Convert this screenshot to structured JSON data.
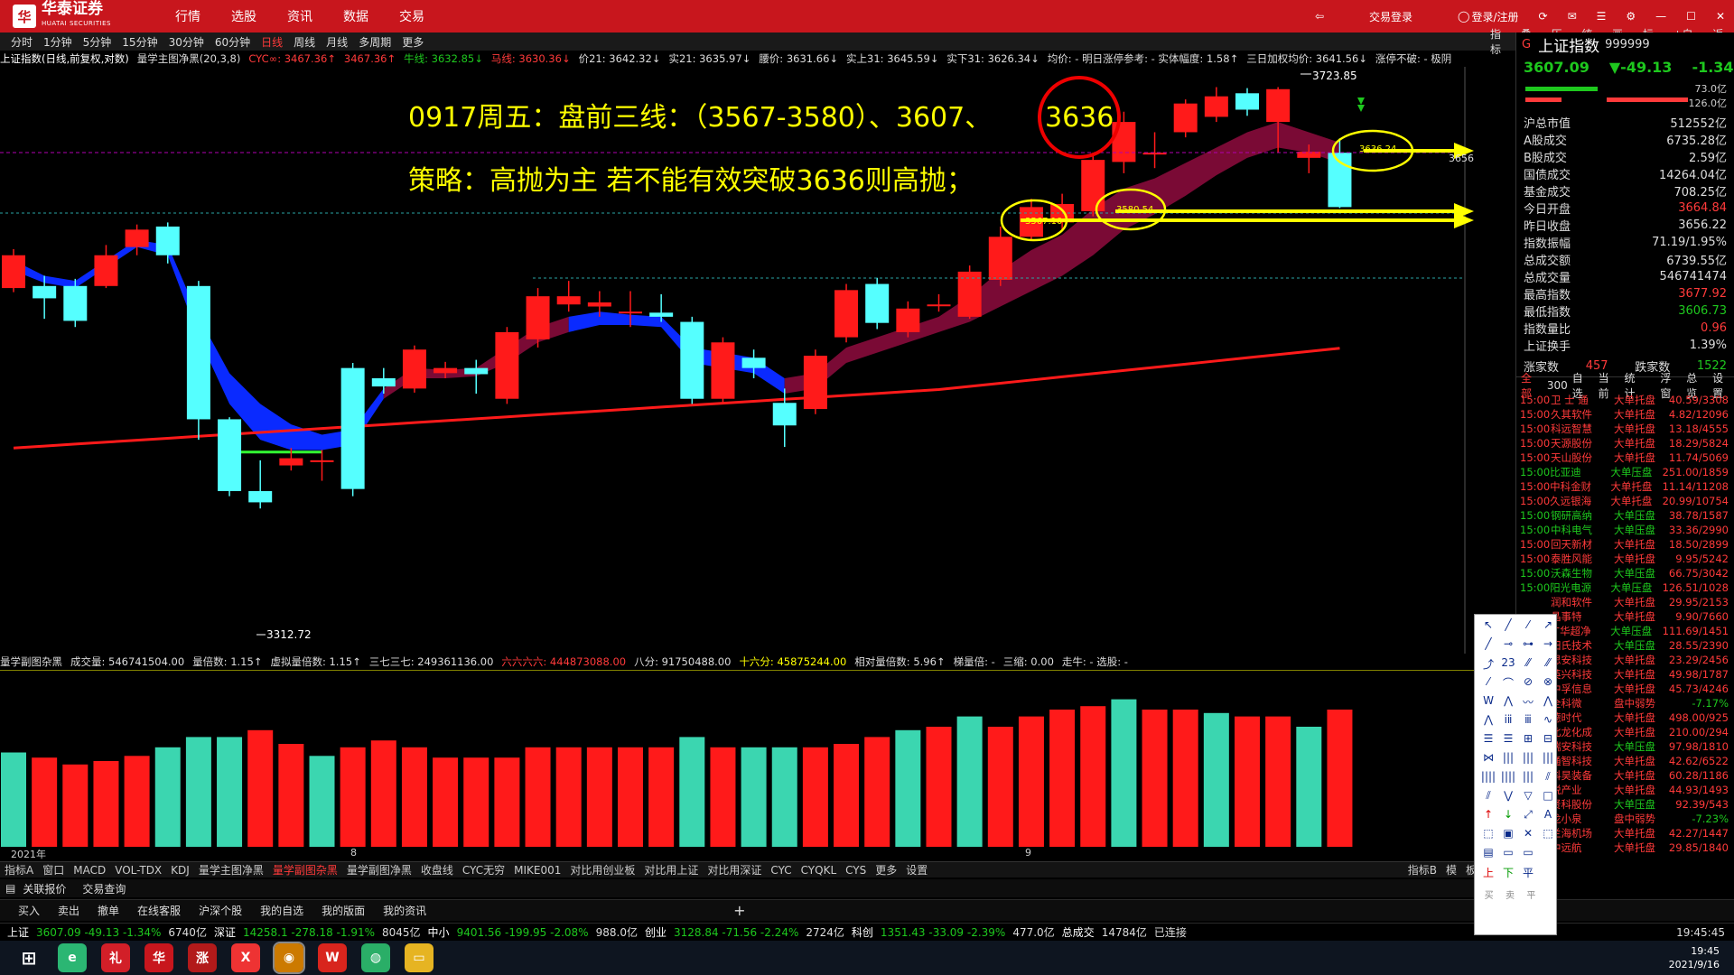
{
  "topbar": {
    "logo_text": "华泰证券",
    "logo_sub": "HUATAI SECURITIES",
    "menu": [
      "行情",
      "选股",
      "资讯",
      "数据",
      "交易"
    ],
    "right_items": [
      "交易登录",
      "登录/注册"
    ]
  },
  "period_bar": {
    "items": [
      "分时",
      "1分钟",
      "5分钟",
      "15分钟",
      "30分钟",
      "60分钟",
      "日线",
      "周线",
      "月线",
      "多周期",
      "更多"
    ],
    "active": "日线"
  },
  "tools_bar": [
    "指标",
    "叠加",
    "历史",
    "统计",
    "画线",
    "标记",
    "+自选",
    "返回"
  ],
  "info_bar": [
    {
      "text": "上证指数(日线,前复权,对数)",
      "color": "#ffffff"
    },
    {
      "text": "量学主图净黑(20,3,8)",
      "color": "#dddddd"
    },
    {
      "text": "CYC∞: 3467.36↑",
      "color": "#ff3a3a"
    },
    {
      "text": "3467.36↑",
      "color": "#ff3a3a"
    },
    {
      "text": "牛线: 3632.85↓",
      "color": "#1ec81e"
    },
    {
      "text": "马线: 3630.36↓",
      "color": "#ff3a3a"
    },
    {
      "text": "价21: 3642.32↓",
      "color": "#dddddd"
    },
    {
      "text": "实21: 3635.97↓",
      "color": "#dddddd"
    },
    {
      "text": "腰价: 3631.66↓",
      "color": "#dddddd"
    },
    {
      "text": "实上31: 3645.59↓",
      "color": "#dddddd"
    },
    {
      "text": "实下31: 3626.34↓",
      "color": "#dddddd"
    },
    {
      "text": "均价: - 明日涨停参考: - 实体幅度: 1.58↑",
      "color": "#dddddd"
    },
    {
      "text": "三日加权均价: 3641.56↓",
      "color": "#dddddd"
    },
    {
      "text": "涨停不破: - 极阴",
      "color": "#dddddd"
    }
  ],
  "annotations": {
    "line1": "0917周五：盘前三线：（3567-3580）、3607、",
    "line1_circled": "3636",
    "line2": "策略：高抛为主  若不能有效突破3636则高抛；",
    "price_high": "3723.85",
    "price_low": "3312.72",
    "label_3567": "3567.10",
    "label_3580": "3580.54",
    "label_3636": "3636.24",
    "axis_right": "3656"
  },
  "chart_data": {
    "type": "candlestick",
    "title": "上证指数(日线,前复权,对数)",
    "candles": [
      {
        "o": 3528,
        "c": 3560,
        "h": 3566,
        "l": 3524
      },
      {
        "o": 3530,
        "c": 3518,
        "h": 3540,
        "l": 3498
      },
      {
        "o": 3530,
        "c": 3496,
        "h": 3537,
        "l": 3490
      },
      {
        "o": 3530,
        "c": 3560,
        "h": 3570,
        "l": 3528
      },
      {
        "o": 3568,
        "c": 3585,
        "h": 3590,
        "l": 3560
      },
      {
        "o": 3588,
        "c": 3560,
        "h": 3592,
        "l": 3552
      },
      {
        "o": 3530,
        "c": 3400,
        "h": 3535,
        "l": 3380
      },
      {
        "o": 3400,
        "c": 3330,
        "h": 3402,
        "l": 3325
      },
      {
        "o": 3330,
        "c": 3319,
        "h": 3360,
        "l": 3313
      },
      {
        "o": 3355,
        "c": 3362,
        "h": 3372,
        "l": 3350
      },
      {
        "o": 3360,
        "c": 3360,
        "h": 3370,
        "l": 3340
      },
      {
        "o": 3450,
        "c": 3332,
        "h": 3455,
        "l": 3325
      },
      {
        "o": 3440,
        "c": 3432,
        "h": 3450,
        "l": 3425
      },
      {
        "o": 3430,
        "c": 3468,
        "h": 3472,
        "l": 3426
      },
      {
        "o": 3445,
        "c": 3450,
        "h": 3456,
        "l": 3440
      },
      {
        "o": 3450,
        "c": 3444,
        "h": 3458,
        "l": 3425
      },
      {
        "o": 3420,
        "c": 3485,
        "h": 3490,
        "l": 3415
      },
      {
        "o": 3478,
        "c": 3520,
        "h": 3528,
        "l": 3470
      },
      {
        "o": 3512,
        "c": 3520,
        "h": 3535,
        "l": 3505
      },
      {
        "o": 3510,
        "c": 3514,
        "h": 3525,
        "l": 3500
      },
      {
        "o": 3505,
        "c": 3505,
        "h": 3525,
        "l": 3490
      },
      {
        "o": 3504,
        "c": 3500,
        "h": 3522,
        "l": 3495
      },
      {
        "o": 3495,
        "c": 3420,
        "h": 3500,
        "l": 3415
      },
      {
        "o": 3420,
        "c": 3475,
        "h": 3480,
        "l": 3415
      },
      {
        "o": 3460,
        "c": 3450,
        "h": 3468,
        "l": 3440
      },
      {
        "o": 3416,
        "c": 3394,
        "h": 3430,
        "l": 3373
      },
      {
        "o": 3410,
        "c": 3462,
        "h": 3468,
        "l": 3405
      },
      {
        "o": 3480,
        "c": 3526,
        "h": 3532,
        "l": 3475
      },
      {
        "o": 3532,
        "c": 3494,
        "h": 3538,
        "l": 3488
      },
      {
        "o": 3485,
        "c": 3508,
        "h": 3515,
        "l": 3480
      },
      {
        "o": 3512,
        "c": 3512,
        "h": 3522,
        "l": 3505
      },
      {
        "o": 3500,
        "c": 3544,
        "h": 3550,
        "l": 3498
      },
      {
        "o": 3536,
        "c": 3578,
        "h": 3588,
        "l": 3530
      },
      {
        "o": 3578,
        "c": 3607,
        "h": 3615,
        "l": 3575
      },
      {
        "o": 3592,
        "c": 3610,
        "h": 3620,
        "l": 3585
      },
      {
        "o": 3603,
        "c": 3653,
        "h": 3660,
        "l": 3598
      },
      {
        "o": 3651,
        "c": 3690,
        "h": 3700,
        "l": 3640
      },
      {
        "o": 3660,
        "c": 3660,
        "h": 3680,
        "l": 3645
      },
      {
        "o": 3680,
        "c": 3708,
        "h": 3712,
        "l": 3675
      },
      {
        "o": 3695,
        "c": 3715,
        "h": 3724,
        "l": 3690
      },
      {
        "o": 3718,
        "c": 3702,
        "h": 3723,
        "l": 3696
      },
      {
        "o": 3690,
        "c": 3722,
        "h": 3724,
        "l": 3660
      },
      {
        "o": 3655,
        "c": 3661,
        "h": 3668,
        "l": 3640
      },
      {
        "o": 3660,
        "c": 3607,
        "h": 3674,
        "l": 3606
      }
    ],
    "volume_colors": [
      "g",
      "r",
      "r",
      "r",
      "r",
      "g",
      "g",
      "g",
      "r",
      "r",
      "g",
      "r",
      "r",
      "r",
      "r",
      "r",
      "r",
      "r",
      "r",
      "r",
      "r",
      "r",
      "g",
      "r",
      "g",
      "g",
      "r",
      "r",
      "r",
      "g",
      "r",
      "g",
      "r",
      "r",
      "r",
      "r",
      "g",
      "r",
      "r",
      "g",
      "r",
      "r",
      "g",
      "r"
    ],
    "volume_levels": [
      0.55,
      0.52,
      0.48,
      0.5,
      0.53,
      0.58,
      0.64,
      0.64,
      0.68,
      0.6,
      0.53,
      0.58,
      0.62,
      0.58,
      0.52,
      0.52,
      0.52,
      0.58,
      0.58,
      0.58,
      0.58,
      0.58,
      0.64,
      0.58,
      0.58,
      0.58,
      0.58,
      0.6,
      0.64,
      0.68,
      0.7,
      0.76,
      0.7,
      0.76,
      0.8,
      0.82,
      0.86,
      0.8,
      0.8,
      0.78,
      0.76,
      0.76,
      0.7,
      0.8
    ]
  },
  "vol_info": [
    {
      "text": "量学副图杂黑",
      "color": "#dddddd"
    },
    {
      "text": "成交量: 546741504.00",
      "color": "#dddddd"
    },
    {
      "text": "量倍数: 1.15↑",
      "color": "#dddddd"
    },
    {
      "text": "虚拟量倍数: 1.15↑",
      "color": "#dddddd"
    },
    {
      "text": "三七三七: 249361136.00",
      "color": "#dddddd"
    },
    {
      "text": "六六六六: 444873088.00",
      "color": "#ff3a3a"
    },
    {
      "text": "八分: 91750488.00",
      "color": "#dddddd"
    },
    {
      "text": "十六分: 45875244.00",
      "color": "#ffff00"
    },
    {
      "text": "相对量倍数: 5.96↑",
      "color": "#dddddd"
    },
    {
      "text": "梯量倍: -",
      "color": "#dddddd"
    },
    {
      "text": "三缩: 0.00",
      "color": "#dddddd"
    },
    {
      "text": "走牛: - 选股: -",
      "color": "#dddddd"
    }
  ],
  "date_labels": [
    "2021年",
    "8",
    "9"
  ],
  "indicator_tabs": {
    "items": [
      "指标A",
      "窗口",
      "MACD",
      "VOL-TDX",
      "KDJ",
      "量学主图净黑",
      "量学副图杂黑",
      "量学副图净黑",
      "收盘线",
      "CYC无穷",
      "MIKE001",
      "对比用创业板",
      "对比用上证",
      "对比用深证",
      "CYC",
      "CYQKL",
      "CYS",
      "更多",
      "设置"
    ],
    "active": "量学副图杂黑",
    "right": [
      "指标B",
      "模",
      "板"
    ]
  },
  "quick_tabs": [
    "关联报价",
    "交易查询"
  ],
  "trade_bar": [
    "买入",
    "卖出",
    "撤单",
    "在线客服",
    "沪深个股",
    "我的自选",
    "我的版面",
    "我的资讯"
  ],
  "status_bar": [
    {
      "text": "上证",
      "color": "#ffffff"
    },
    {
      "text": "3607.09 -49.13 -1.34%",
      "color": "#1ec81e"
    },
    {
      "text": "6740亿",
      "color": "#dddddd"
    },
    {
      "text": "深证",
      "color": "#ffffff"
    },
    {
      "text": "14258.1 -278.18 -1.91%",
      "color": "#1ec81e"
    },
    {
      "text": "8045亿",
      "color": "#dddddd"
    },
    {
      "text": "中小",
      "color": "#ffffff"
    },
    {
      "text": "9401.56 -199.95 -2.08%",
      "color": "#1ec81e"
    },
    {
      "text": "988.0亿",
      "color": "#dddddd"
    },
    {
      "text": "创业",
      "color": "#ffffff"
    },
    {
      "text": "3128.84 -71.56 -2.24%",
      "color": "#1ec81e"
    },
    {
      "text": "2724亿",
      "color": "#dddddd"
    },
    {
      "text": "科创",
      "color": "#ffffff"
    },
    {
      "text": "1351.43 -33.09 -2.39%",
      "color": "#1ec81e"
    },
    {
      "text": "477.0亿",
      "color": "#dddddd"
    },
    {
      "text": "总成交",
      "color": "#ffffff"
    },
    {
      "text": "14784亿",
      "color": "#dddddd"
    },
    {
      "text": "已连接",
      "color": "#dddddd"
    },
    {
      "text": "19:45:45",
      "color": "#dddddd"
    }
  ],
  "side_panel": {
    "g": "G",
    "title": "上证指数",
    "code": "999999",
    "price": "3607.09",
    "change": "▼-49.13",
    "change_pct": "-1.34%",
    "bar_vals": [
      "73.0亿",
      "126.0亿"
    ],
    "rows": [
      {
        "k": "沪总市值",
        "v": "512552亿",
        "c": "#dddddd"
      },
      {
        "k": "A股成交",
        "v": "6735.28亿",
        "c": "#dddddd"
      },
      {
        "k": "B股成交",
        "v": "2.59亿",
        "c": "#dddddd"
      },
      {
        "k": "国债成交",
        "v": "14264.04亿",
        "c": "#dddddd"
      },
      {
        "k": "基金成交",
        "v": "708.25亿",
        "c": "#dddddd"
      },
      {
        "k": "今日开盘",
        "v": "3664.84",
        "c": "#ff3a3a"
      },
      {
        "k": "昨日收盘",
        "v": "3656.22",
        "c": "#dddddd"
      },
      {
        "k": "指数振幅",
        "v": "71.19/1.95%",
        "c": "#dddddd"
      },
      {
        "k": "总成交额",
        "v": "6739.55亿",
        "c": "#dddddd"
      },
      {
        "k": "总成交量",
        "v": "546741474",
        "c": "#dddddd"
      },
      {
        "k": "最高指数",
        "v": "3677.92",
        "c": "#ff3a3a"
      },
      {
        "k": "最低指数",
        "v": "3606.73",
        "c": "#1ec81e"
      },
      {
        "k": "指数量比",
        "v": "0.96",
        "c": "#ff3a3a"
      },
      {
        "k": "上证换手",
        "v": "1.39%",
        "c": "#dddddd"
      }
    ],
    "up_label": "涨家数",
    "up_value": "457",
    "down_label": "跌家数",
    "down_value": "1522",
    "list_tabs": [
      "全部",
      "300",
      "自选",
      "当前",
      "统计",
      "浮窗",
      "总览",
      "设置"
    ],
    "stocks": [
      {
        "t": "15:00",
        "n": "卫 士 通",
        "s": "大单托盘",
        "v": "40.59/3308",
        "nc": "#ff3a3a"
      },
      {
        "t": "15:00",
        "n": "久其软件",
        "s": "大单托盘",
        "v": "4.82/12096",
        "nc": "#ff3a3a"
      },
      {
        "t": "15:00",
        "n": "科远智慧",
        "s": "大单托盘",
        "v": "13.18/4555",
        "nc": "#ff3a3a"
      },
      {
        "t": "15:00",
        "n": "天源股份",
        "s": "大单托盘",
        "v": "18.29/5824",
        "nc": "#ff3a3a"
      },
      {
        "t": "15:00",
        "n": "天山股份",
        "s": "大单托盘",
        "v": "11.74/5069",
        "nc": "#ff3a3a"
      },
      {
        "t": "15:00",
        "n": "比亚迪",
        "s": "大单压盘",
        "v": "251.00/1859",
        "nc": "#1ec81e"
      },
      {
        "t": "15:00",
        "n": "中科金财",
        "s": "大单托盘",
        "v": "11.14/11208",
        "nc": "#ff3a3a"
      },
      {
        "t": "15:00",
        "n": "久远银海",
        "s": "大单托盘",
        "v": "20.99/10754",
        "nc": "#ff3a3a"
      },
      {
        "t": "15:00",
        "n": "钢研高纳",
        "s": "大单压盘",
        "v": "38.78/1587",
        "nc": "#1ec81e"
      },
      {
        "t": "15:00",
        "n": "中科电气",
        "s": "大单压盘",
        "v": "33.36/2990",
        "nc": "#1ec81e"
      },
      {
        "t": "15:00",
        "n": "回天新材",
        "s": "大单托盘",
        "v": "18.50/2899",
        "nc": "#ff3a3a"
      },
      {
        "t": "15:00",
        "n": "泰胜风能",
        "s": "大单托盘",
        "v": "9.95/5242",
        "nc": "#ff3a3a"
      },
      {
        "t": "15:00",
        "n": "沃森生物",
        "s": "大单压盘",
        "v": "66.75/3042",
        "nc": "#1ec81e"
      },
      {
        "t": "15:00",
        "n": "阳光电源",
        "s": "大单压盘",
        "v": "126.51/1028",
        "nc": "#1ec81e"
      },
      {
        "t": "",
        "n": "润和软件",
        "s": "大单托盘",
        "v": "29.95/2153",
        "nc": "#ff3a3a"
      },
      {
        "t": "",
        "n": "晶事特",
        "s": "大单托盘",
        "v": "9.90/7660",
        "nc": "#ff3a3a"
      },
      {
        "t": "",
        "n": "广华超净",
        "s": "大单压盘",
        "v": "111.69/1451",
        "nc": "#ff3a3a"
      },
      {
        "t": "",
        "n": "阳氏技术",
        "s": "大单压盘",
        "v": "28.55/2390",
        "nc": "#ff3a3a"
      },
      {
        "t": "",
        "n": "思安科技",
        "s": "大单托盘",
        "v": "23.29/2456",
        "nc": "#ff3a3a"
      },
      {
        "t": "",
        "n": "英兴科技",
        "s": "大单托盘",
        "v": "49.98/1787",
        "nc": "#ff3a3a"
      },
      {
        "t": "",
        "n": "中孚信息",
        "s": "大单托盘",
        "v": "45.73/4246",
        "nc": "#ff3a3a"
      },
      {
        "t": "",
        "n": "全科微",
        "s": "盘中弱势",
        "v": "-7.17%",
        "nc": "#ff3a3a"
      },
      {
        "t": "",
        "n": "德时代",
        "s": "大单托盘",
        "v": "498.00/925",
        "nc": "#ff3a3a"
      },
      {
        "t": "",
        "n": "北龙化成",
        "s": "大单托盘",
        "v": "210.00/294",
        "nc": "#ff3a3a"
      },
      {
        "t": "",
        "n": "瑞安科技",
        "s": "大单压盘",
        "v": "97.98/1810",
        "nc": "#ff3a3a"
      },
      {
        "t": "",
        "n": "通智科技",
        "s": "大单托盘",
        "v": "42.62/6522",
        "nc": "#ff3a3a"
      },
      {
        "t": "",
        "n": "科昊装备",
        "s": "大单托盘",
        "v": "60.28/1186",
        "nc": "#ff3a3a"
      },
      {
        "t": "",
        "n": "锐产业",
        "s": "大单托盘",
        "v": "44.93/1493",
        "nc": "#ff3a3a"
      },
      {
        "t": "",
        "n": "贤科股份",
        "s": "大单压盘",
        "v": "92.39/543",
        "nc": "#ff3a3a"
      },
      {
        "t": "",
        "n": "龙小泉",
        "s": "盘中弱势",
        "v": "-7.23%",
        "nc": "#ff3a3a"
      },
      {
        "t": "",
        "n": "兰海机场",
        "s": "大单托盘",
        "v": "42.27/1447",
        "nc": "#ff3a3a"
      },
      {
        "t": "",
        "n": "中远航",
        "s": "大单托盘",
        "v": "29.85/1840",
        "nc": "#ff3a3a"
      }
    ]
  },
  "draw_tools": [
    "↖",
    "╱",
    "⁄",
    "↗",
    "╱",
    "⊸",
    "⊶",
    "→",
    "⤴",
    "23",
    "⁄⁄",
    "⁄⁄",
    "⁄",
    "⌒",
    "⊘",
    "⊗",
    "W",
    "⋀",
    "〰",
    "⋀",
    "⋀",
    "ⅰⅱ",
    "ⅲ",
    "∿",
    "☰",
    "☰",
    "⊞",
    "⊟",
    "⋈",
    "|||",
    "|||",
    "|||",
    "||||",
    "||||",
    "|||",
    "⫽",
    "⫽",
    "⋁",
    "▽",
    "□",
    "↑",
    "↓",
    "⤢",
    "A",
    "⬚",
    "▣",
    "✕",
    "⬚",
    "▤",
    "▭",
    "▭",
    "",
    "上",
    "下",
    "平",
    ""
  ],
  "draw_labels": [
    "买",
    "卖",
    "平"
  ],
  "taskbar": {
    "clock_time": "19:45",
    "clock_date": "2021/9/16"
  }
}
